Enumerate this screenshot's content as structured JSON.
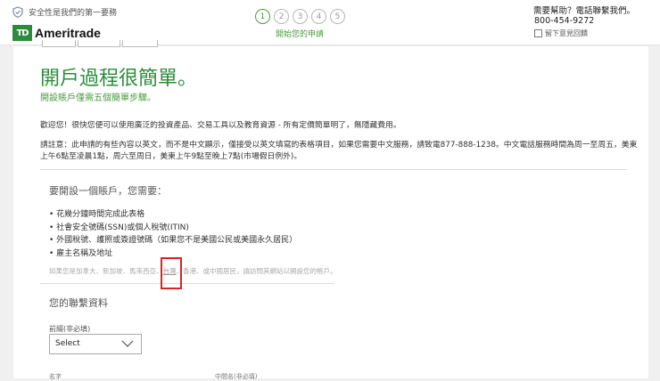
{
  "header": {
    "secure_text": "安全性是我們的第一要務",
    "logo_mark": "TD",
    "logo_text": "Ameritrade",
    "steps": [
      "1",
      "2",
      "3",
      "4",
      "5"
    ],
    "step_label": "開始您的申請",
    "help_title": "需要幫助？電話聯繫我們。",
    "phone": "800-454-9272",
    "feedback": "留下意見回饋"
  },
  "intro": {
    "heading": "開戶過程很簡單。",
    "subheading": "開設賬戶僅需五個簡單步驟。",
    "welcome": "歡迎您！很快您便可以使用廣泛的投資產品、交易工具以及教育資源 - 所有定價簡單明了，無隱藏費用。",
    "notice": "請註意：此申請的有些內容以英文，而不是中文顯示，僅接受以英文填寫的表格項目，如果您需要中文服務，請致電877-888-1238。中文電話服務時間為周一至周五，美東上午6點至凌晨1點，周六至周日，美東上午9點至晚上7點(市場假日例外)。"
  },
  "requirements": {
    "heading": "要開設一個賬戶，您需要：",
    "items": [
      "花幾分鐘時間完成此表格",
      "社會安全號碼(SSN)或個人稅號(ITIN)",
      "外國稅號、護照或簽證號碼（如果您不是美國公民或美國永久居民）",
      "雇主名稱及地址"
    ],
    "countries_pre": "如果您是加拿大、新加坡、馬來西亞、",
    "countries_highlight": "台灣",
    "countries_post": "、香港、或中國居民，請訪問其網站以開設您的帳戶。"
  },
  "contact": {
    "heading": "您的聯繫資料",
    "prefix_label": "前綴(非必填)",
    "prefix_value": "Select",
    "name_label": "名字",
    "middle_label": "中間名(非必填)"
  }
}
